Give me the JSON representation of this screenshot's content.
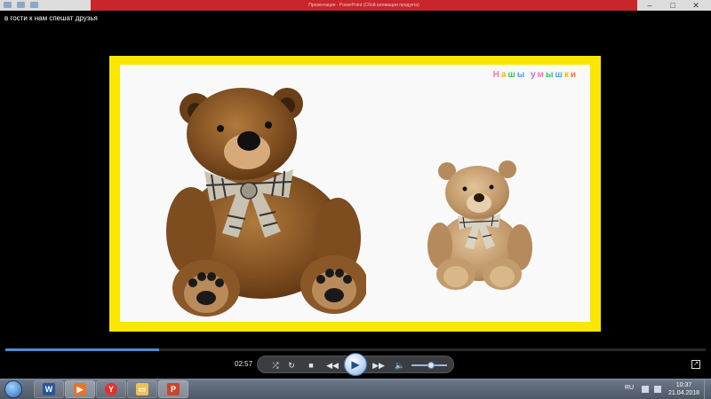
{
  "ppt_window": {
    "title": "Презентация - PowerPoint (Сбой активации продукта)",
    "controls": [
      "–",
      "□",
      "✕"
    ]
  },
  "player": {
    "title": "в гости к нам спешат друзья",
    "elapsed": "02:57",
    "progress_fraction": 0.22,
    "volume_fraction": 0.55
  },
  "slide": {
    "brand": "Нашы умышки",
    "brand_colors": [
      "#ff6fb5",
      "#f4b400",
      "#39c55a",
      "#4aa0ff",
      "#ff6b3d",
      "#b06bff",
      "#ff6fb5",
      "#39c55a",
      "#4aa0ff",
      "#f4b400",
      "#ff6b3d",
      "#b06bff"
    ],
    "frame_color": "#fbe600"
  },
  "controls": {
    "shuffle_icon": "shuffle-icon",
    "repeat_icon": "repeat-icon",
    "stop_icon": "stop-icon",
    "prev_icon": "rewind-icon",
    "play_icon": "play-icon",
    "next_icon": "fast-forward-icon",
    "volume_icon": "speaker-icon"
  },
  "taskbar": {
    "apps": [
      {
        "name": "word",
        "label": "W",
        "color": "#2a5699"
      },
      {
        "name": "media-player",
        "label": "▶",
        "color": "#e8732a"
      },
      {
        "name": "yandex",
        "label": "Y",
        "color": "#e0312b"
      },
      {
        "name": "explorer",
        "label": "▭",
        "color": "#e9c25a"
      },
      {
        "name": "powerpoint",
        "label": "P",
        "color": "#c9452c"
      }
    ],
    "lang": "RU",
    "time": "10:37",
    "date": "21.04.2018"
  }
}
